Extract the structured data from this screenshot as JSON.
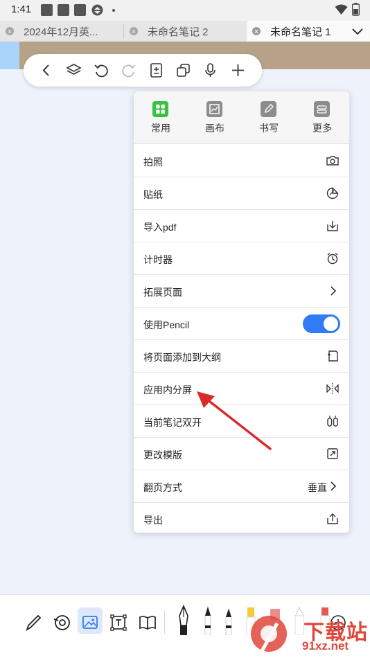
{
  "status_bar": {
    "time": "1:41"
  },
  "tabs": [
    {
      "label": "2024年12月英...",
      "active": false
    },
    {
      "label": "未命名笔记 2",
      "active": false
    },
    {
      "label": "未命名笔记 1",
      "active": true
    }
  ],
  "float_toolbar": {
    "buttons": [
      "back-icon",
      "layers-icon",
      "undo-icon",
      "redo-icon",
      "page-icon",
      "copy-icon",
      "microphone-icon",
      "add-icon"
    ]
  },
  "menu": {
    "tabs": [
      {
        "label": "常用",
        "active": true
      },
      {
        "label": "画布",
        "active": false
      },
      {
        "label": "书写",
        "active": false
      },
      {
        "label": "更多",
        "active": false
      }
    ],
    "items": [
      {
        "label": "拍照",
        "icon": "camera-icon"
      },
      {
        "label": "贴纸",
        "icon": "sticker-icon"
      },
      {
        "label": "导入pdf",
        "icon": "import-icon"
      },
      {
        "label": "计时器",
        "icon": "alarm-clock-icon"
      },
      {
        "label": "拓展页面",
        "icon": "chevron-right-icon"
      },
      {
        "label": "使用Pencil",
        "toggle": true
      },
      {
        "label": "将页面添加到大纲",
        "icon": "outline-add-icon"
      },
      {
        "label": "应用内分屏",
        "icon": "split-screen-icon"
      },
      {
        "label": "当前笔记双开",
        "icon": "dual-open-icon"
      },
      {
        "label": "更改模版",
        "icon": "template-icon"
      },
      {
        "label": "翻页方式",
        "value": "垂直",
        "icon": "chevron-right-icon"
      },
      {
        "label": "导出",
        "icon": "share-icon"
      }
    ]
  },
  "colors": {
    "accent": "#2f7cf6",
    "active_tab": "#36c33f",
    "annotation": "#d92b2b"
  },
  "watermark": {
    "text": "下载站",
    "sub": "91xz.net"
  }
}
